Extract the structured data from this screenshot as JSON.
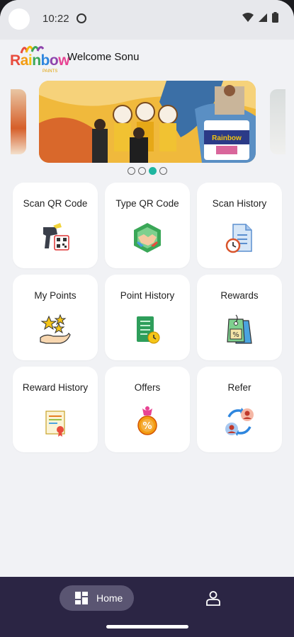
{
  "status_bar": {
    "time": "10:22"
  },
  "header": {
    "logo_text": "Rainbow",
    "logo_sub": "PAINTS",
    "welcome": "Welcome Sonu"
  },
  "banner": {
    "product_label": "Rainbow",
    "carousel": {
      "count": 4,
      "active_index": 2
    }
  },
  "tiles": [
    {
      "label": "Scan QR Code",
      "icon": "barcode-scanner-icon"
    },
    {
      "label": "Type QR Code",
      "icon": "handshake-icon"
    },
    {
      "label": "Scan History",
      "icon": "history-document-icon"
    },
    {
      "label": "My Points",
      "icon": "stars-hand-icon"
    },
    {
      "label": "Point History",
      "icon": "ledger-clock-icon"
    },
    {
      "label": "Rewards",
      "icon": "discount-tags-icon"
    },
    {
      "label": "Reward History",
      "icon": "certificate-icon"
    },
    {
      "label": "Offers",
      "icon": "medal-icon"
    },
    {
      "label": "Refer",
      "icon": "refer-users-icon"
    }
  ],
  "bottom_nav": {
    "home_label": "Home",
    "colors": {
      "bar": "#2b2544",
      "active_pill": "#5a5572"
    }
  },
  "colors": {
    "accent": "#1fb6a0",
    "background": "#f1f2f5"
  }
}
